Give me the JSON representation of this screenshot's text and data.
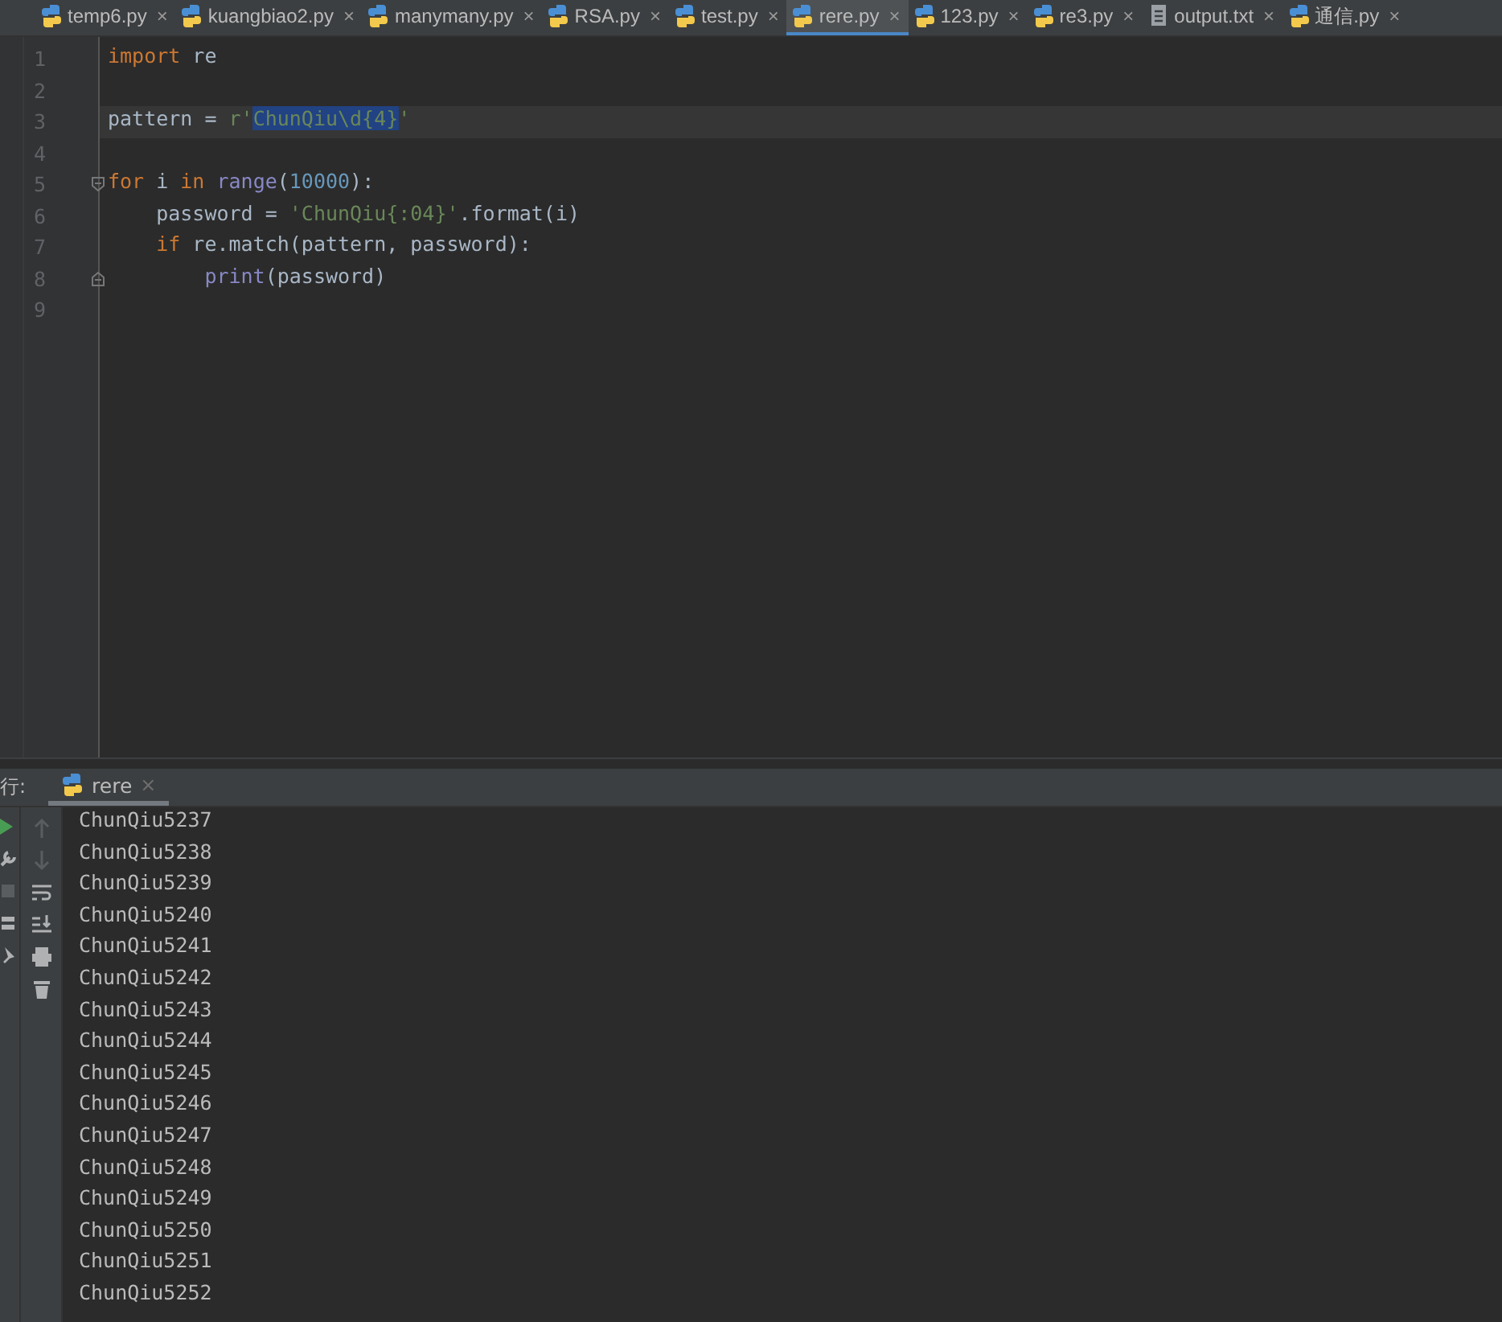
{
  "tabs": [
    {
      "label": "temp6.py",
      "kind": "python",
      "selected": false
    },
    {
      "label": "kuangbiao2.py",
      "kind": "python",
      "selected": false
    },
    {
      "label": "manymany.py",
      "kind": "python",
      "selected": false
    },
    {
      "label": "RSA.py",
      "kind": "python",
      "selected": false
    },
    {
      "label": "test.py",
      "kind": "python",
      "selected": false
    },
    {
      "label": "rere.py",
      "kind": "python",
      "selected": true
    },
    {
      "label": "123.py",
      "kind": "python",
      "selected": false
    },
    {
      "label": "re3.py",
      "kind": "python",
      "selected": false
    },
    {
      "label": "output.txt",
      "kind": "text",
      "selected": false
    },
    {
      "label": "通信.py",
      "kind": "python",
      "selected": false
    }
  ],
  "tab_close": "×",
  "editor": {
    "lines": [
      {
        "number": "1",
        "current": false,
        "fold_start": false,
        "fold_end": false,
        "tokens": [
          {
            "kind": "keyword",
            "text": "import"
          },
          {
            "kind": "plain",
            "text": " re"
          }
        ]
      },
      {
        "number": "2",
        "current": false,
        "fold_start": false,
        "fold_end": false
      },
      {
        "number": "3",
        "current": true,
        "fold_start": false,
        "fold_end": false,
        "tokens": [
          {
            "kind": "plain",
            "text": "pattern = "
          },
          {
            "kind": "string",
            "text": "r'"
          },
          {
            "kind": "selection",
            "text": "ChunQiu\\d{4}"
          },
          {
            "kind": "string",
            "text": "'"
          }
        ]
      },
      {
        "number": "4",
        "current": false,
        "fold_start": false,
        "fold_end": false
      },
      {
        "number": "5",
        "current": false,
        "fold_start": true,
        "fold_end": false,
        "tokens": [
          {
            "kind": "keyword",
            "text": "for"
          },
          {
            "kind": "plain",
            "text": " i "
          },
          {
            "kind": "keyword",
            "text": "in"
          },
          {
            "kind": "builtin",
            "text": " range"
          },
          {
            "kind": "plain",
            "text": "("
          },
          {
            "kind": "number",
            "text": "10000"
          },
          {
            "kind": "plain",
            "text": "):"
          }
        ]
      },
      {
        "number": "6",
        "current": false,
        "fold_start": false,
        "fold_end": false,
        "tokens": [
          {
            "kind": "plain",
            "text": "    password = "
          },
          {
            "kind": "string",
            "text": "'ChunQiu{:04}'"
          },
          {
            "kind": "plain",
            "text": ".format(i)"
          }
        ]
      },
      {
        "number": "7",
        "current": false,
        "fold_start": false,
        "fold_end": false,
        "tokens": [
          {
            "kind": "keyword",
            "text": "    if"
          },
          {
            "kind": "plain",
            "text": " re.match(pattern, password):"
          }
        ]
      },
      {
        "number": "8",
        "current": false,
        "fold_start": false,
        "fold_end": true,
        "tokens": [
          {
            "kind": "builtin",
            "text": "        print"
          },
          {
            "kind": "plain",
            "text": "(password)"
          }
        ]
      },
      {
        "number": "9",
        "current": false,
        "fold_start": false,
        "fold_end": false
      }
    ]
  },
  "run_panel": {
    "label": "行:",
    "tab": {
      "label": "rere",
      "close": "×",
      "selected": true
    },
    "output": [
      "ChunQiu5237",
      "ChunQiu5238",
      "ChunQiu5239",
      "ChunQiu5240",
      "ChunQiu5241",
      "ChunQiu5242",
      "ChunQiu5243",
      "ChunQiu5244",
      "ChunQiu5245",
      "ChunQiu5246",
      "ChunQiu5247",
      "ChunQiu5248",
      "ChunQiu5249",
      "ChunQiu5250",
      "ChunQiu5251",
      "ChunQiu5252"
    ]
  }
}
